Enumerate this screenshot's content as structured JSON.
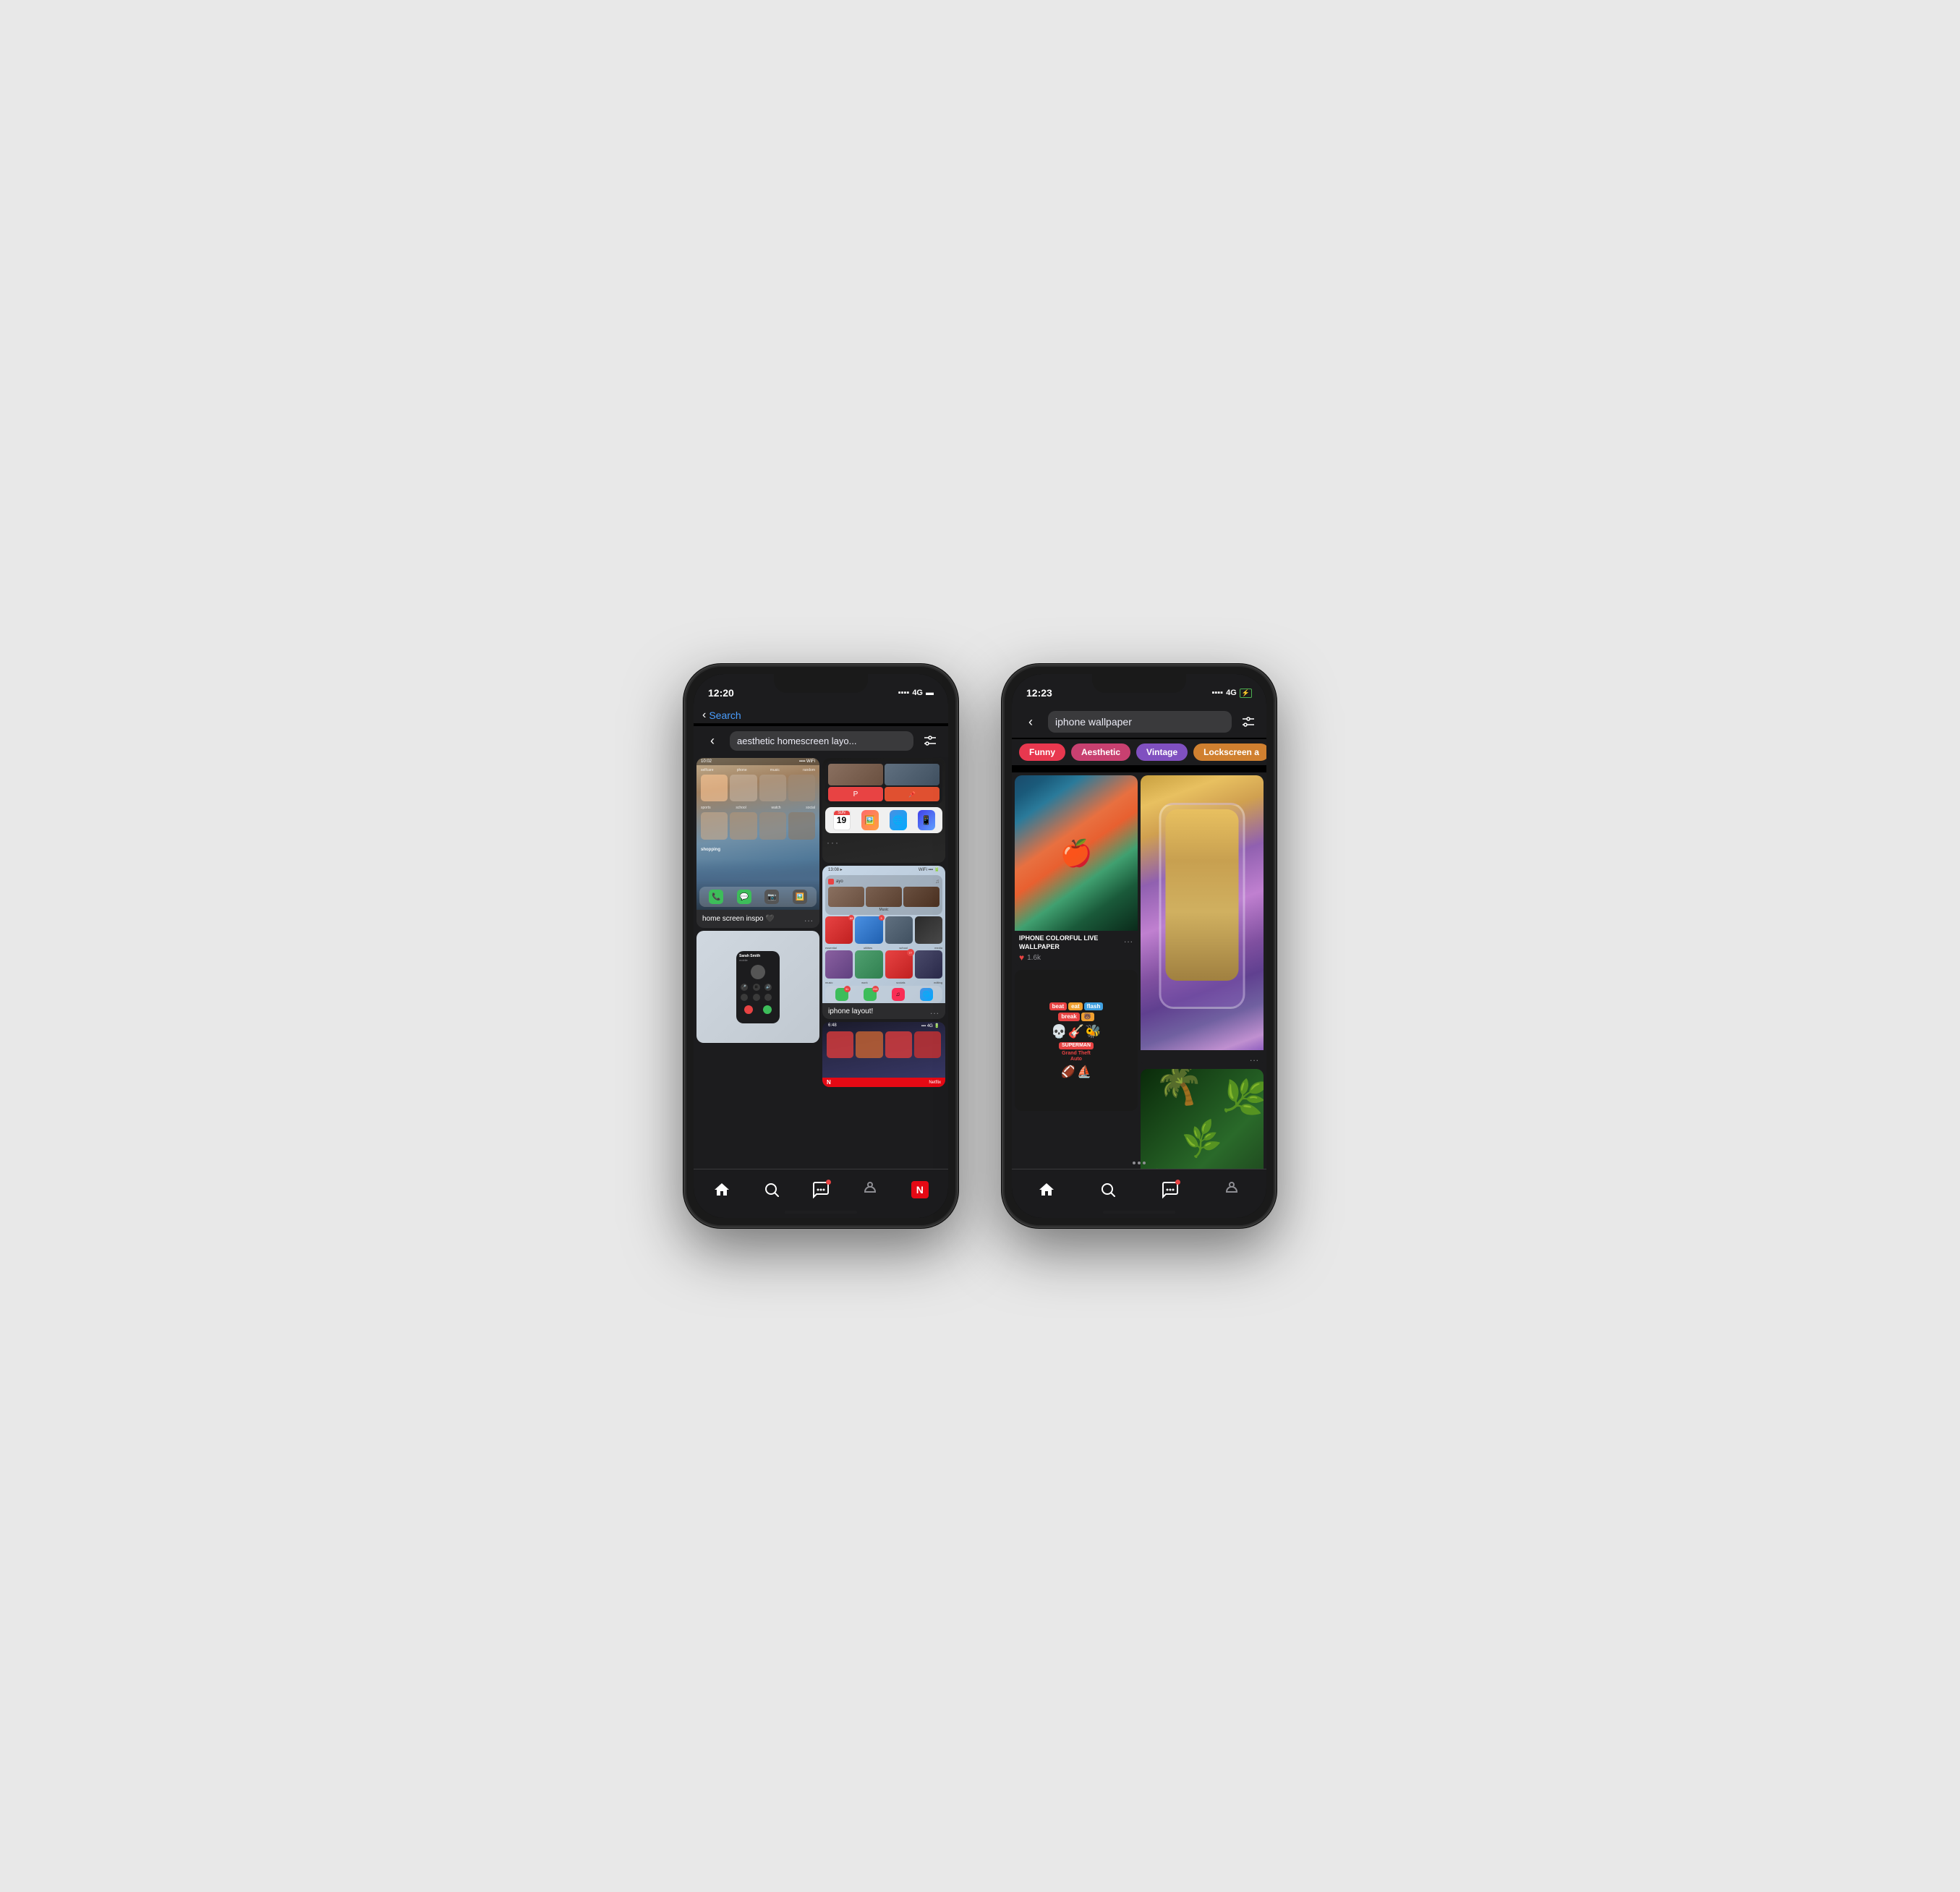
{
  "phone1": {
    "status": {
      "time": "12:20",
      "signal": "▪▪▪▪",
      "network": "4G",
      "battery": "🔋"
    },
    "header": {
      "back_label": "Search",
      "search_text": "aesthetic homescreen layo...",
      "filter_icon": "⊞"
    },
    "card1": {
      "label": "home screen inspo 🖤",
      "dots": "..."
    },
    "card2": {
      "label": "iphone layout!",
      "dots": "..."
    },
    "nav": {
      "home": "⌂",
      "search": "⌕",
      "chat": "💬",
      "pin": "📌",
      "netflix": "N"
    }
  },
  "phone2": {
    "status": {
      "time": "12:23",
      "signal": "▪▪▪▪",
      "network": "4G",
      "battery": "⚡"
    },
    "header": {
      "search_text": "iphone wallpaper",
      "filter_icon": "⊞"
    },
    "tags": [
      {
        "label": "Funny",
        "color": "#e8384f"
      },
      {
        "label": "Aesthetic",
        "color": "#c84070"
      },
      {
        "label": "Vintage",
        "color": "#8050c0"
      },
      {
        "label": "Lockscreen a",
        "color": "#d08030"
      }
    ],
    "card1": {
      "title": "IPHONE COLORFUL LIVE WALLPAPER",
      "likes": "1.6k",
      "dots": "..."
    },
    "card2": {
      "dots": "..."
    },
    "nav": {
      "home": "⌂",
      "search": "⌕",
      "chat": "💬",
      "pin": "📌"
    }
  },
  "colors": {
    "tag_funny": "#e8384f",
    "tag_aesthetic": "#c84070",
    "tag_vintage": "#8050c0",
    "tag_lockscreen": "#d08030",
    "bg_dark": "#1c1c1e",
    "card_bg": "#2c2c2e"
  }
}
